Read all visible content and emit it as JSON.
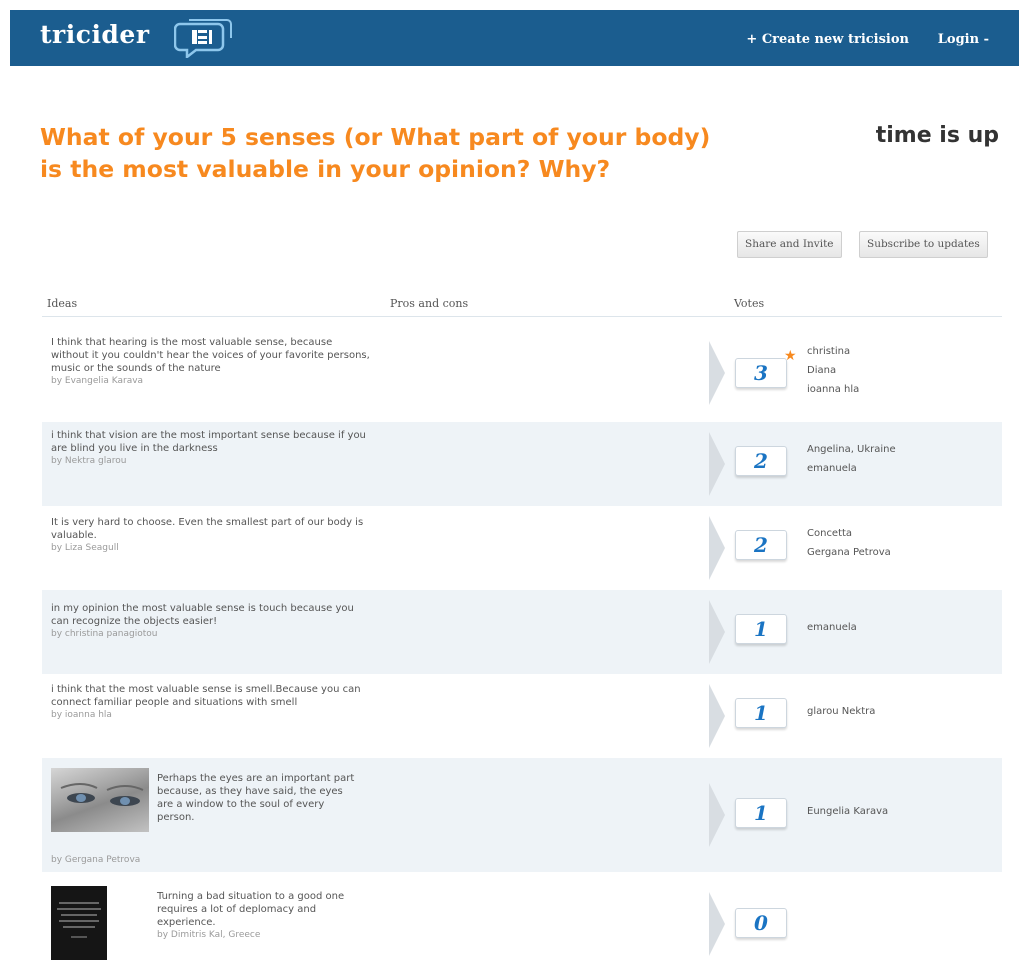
{
  "header": {
    "logo": "tricider",
    "create_label": "+ Create new tricision",
    "login_label": "Login -"
  },
  "title": {
    "question": "What of your 5 senses (or What part of your body) is the most valuable in your opinion? Why?",
    "status": "time is up"
  },
  "actions": {
    "share_label": "Share and Invite",
    "subscribe_label": "Subscribe to updates"
  },
  "columns": {
    "ideas": "Ideas",
    "pros_cons": "Pros and cons",
    "votes": "Votes"
  },
  "ideas": [
    {
      "text": "I think that hearing is the most valuable sense, because without it you couldn't hear the voices of your favorite persons, music or the sounds of the nature",
      "author": "by Evangelia Karava",
      "votes": "3",
      "starred": true,
      "voters": [
        "christina",
        "Diana",
        "ioanna hla"
      ]
    },
    {
      "text": "i think that vision are the most important sense because if you are blind you live in the darkness",
      "author": "by Nektra glarou",
      "votes": "2",
      "voters": [
        "Angelina, Ukraine",
        "emanuela"
      ]
    },
    {
      "text": "It is very hard to choose. Even the smallest part of our body is valuable.",
      "author": "by Liza Seagull",
      "votes": "2",
      "voters": [
        "Concetta",
        "Gergana Petrova"
      ]
    },
    {
      "text": "in my opinion the most valuable sense is touch because you can recognize the objects easier!",
      "author": "by christina panagiotou",
      "votes": "1",
      "voters": [
        "emanuela"
      ]
    },
    {
      "text": "i think that the most valuable sense is smell.Because you can connect familiar people and situations with smell",
      "author": "by ioanna hla",
      "votes": "1",
      "voters": [
        "glarou Nektra"
      ]
    },
    {
      "text": "Perhaps the eyes are an important part because, as they have said, the eyes are a window to the soul of every person.",
      "author": "by Gergana Petrova",
      "votes": "1",
      "voters": [
        "Eungelia Karava"
      ]
    },
    {
      "text": "Turning a bad situation to a good one requires a lot of deplomacy and experience.",
      "author": "by Dimitris Kal, Greece",
      "votes": "0",
      "voters": []
    }
  ]
}
